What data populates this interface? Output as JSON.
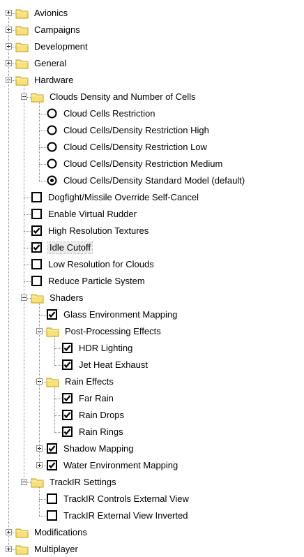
{
  "tree": [
    {
      "label": "Avionics",
      "type": "folder",
      "level": 0,
      "expander": "plus"
    },
    {
      "label": "Campaigns",
      "type": "folder",
      "level": 0,
      "expander": "plus"
    },
    {
      "label": "Development",
      "type": "folder",
      "level": 0,
      "expander": "plus"
    },
    {
      "label": "General",
      "type": "folder",
      "level": 0,
      "expander": "plus"
    },
    {
      "label": "Hardware",
      "type": "folder",
      "level": 0,
      "expander": "minus"
    },
    {
      "label": "Clouds Density and Number of Cells",
      "type": "folder",
      "level": 1,
      "expander": "minus"
    },
    {
      "label": "Cloud Cells Restriction",
      "type": "radio",
      "level": 2,
      "selected": false
    },
    {
      "label": "Cloud Cells/Density Restriction High",
      "type": "radio",
      "level": 2,
      "selected": false
    },
    {
      "label": "Cloud Cells/Density Restriction Low",
      "type": "radio",
      "level": 2,
      "selected": false
    },
    {
      "label": "Cloud Cells/Density Restriction Medium",
      "type": "radio",
      "level": 2,
      "selected": false
    },
    {
      "label": "Cloud Cells/Density Standard Model (default)",
      "type": "radio",
      "level": 2,
      "selected": true
    },
    {
      "label": "Dogfight/Missile Override Self-Cancel",
      "type": "checkbox",
      "level": 1,
      "checked": false
    },
    {
      "label": "Enable Virtual Rudder",
      "type": "checkbox",
      "level": 1,
      "checked": false
    },
    {
      "label": "High Resolution Textures",
      "type": "checkbox",
      "level": 1,
      "checked": true
    },
    {
      "label": "Idle Cutoff",
      "type": "checkbox",
      "level": 1,
      "checked": true,
      "focused": true
    },
    {
      "label": "Low Resolution for Clouds",
      "type": "checkbox",
      "level": 1,
      "checked": false
    },
    {
      "label": "Reduce Particle System",
      "type": "checkbox",
      "level": 1,
      "checked": false
    },
    {
      "label": "Shaders",
      "type": "folder",
      "level": 1,
      "expander": "minus"
    },
    {
      "label": "Glass Environment Mapping",
      "type": "checkbox",
      "level": 2,
      "checked": true
    },
    {
      "label": "Post-Processing Effects",
      "type": "folder",
      "level": 2,
      "expander": "minus"
    },
    {
      "label": "HDR Lighting",
      "type": "checkbox",
      "level": 3,
      "checked": true
    },
    {
      "label": "Jet Heat Exhaust",
      "type": "checkbox",
      "level": 3,
      "checked": true
    },
    {
      "label": "Rain Effects",
      "type": "folder",
      "level": 2,
      "expander": "minus"
    },
    {
      "label": "Far Rain",
      "type": "checkbox",
      "level": 3,
      "checked": true
    },
    {
      "label": "Rain Drops",
      "type": "checkbox",
      "level": 3,
      "checked": true
    },
    {
      "label": "Rain Rings",
      "type": "checkbox",
      "level": 3,
      "checked": true
    },
    {
      "label": "Shadow Mapping",
      "type": "checkbox",
      "level": 2,
      "checked": true,
      "expander": "plus"
    },
    {
      "label": "Water Environment Mapping",
      "type": "checkbox",
      "level": 2,
      "checked": true,
      "expander": "plus"
    },
    {
      "label": "TrackIR Settings",
      "type": "folder",
      "level": 1,
      "expander": "minus"
    },
    {
      "label": "TrackIR Controls External View",
      "type": "checkbox",
      "level": 2,
      "checked": false
    },
    {
      "label": "TrackIR External View Inverted",
      "type": "checkbox",
      "level": 2,
      "checked": false
    },
    {
      "label": "Modifications",
      "type": "folder",
      "level": 0,
      "expander": "plus"
    },
    {
      "label": "Multiplayer",
      "type": "folder",
      "level": 0,
      "expander": "plus"
    }
  ],
  "icons": {
    "folder": "folder-icon",
    "checkbox": "checkbox-icon",
    "radio": "radio-button-icon"
  },
  "colors": {
    "folder_fill": "#f6e27a",
    "folder_stroke": "#c79a10",
    "connector": "#8a8a8a"
  }
}
